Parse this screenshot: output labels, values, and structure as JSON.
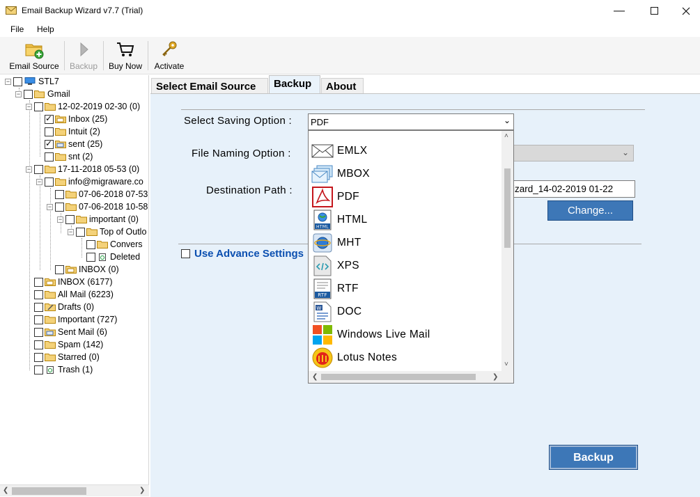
{
  "window": {
    "title": "Email Backup Wizard v7.7 (Trial)"
  },
  "menu": {
    "file": "File",
    "help": "Help"
  },
  "toolbar": {
    "email_source": "Email Source",
    "backup": "Backup",
    "buy_now": "Buy Now",
    "activate": "Activate"
  },
  "tree": {
    "root": "STL7",
    "account": "Gmail",
    "items": [
      "12-02-2019 02-30 (0)",
      "Inbox (25)",
      "Intuit (2)",
      "sent (25)",
      "snt (2)",
      "17-11-2018 05-53 (0)",
      "info@migraware.co",
      "07-06-2018 07-53",
      "07-06-2018 10-58",
      "important (0)",
      "Top of Outlo",
      "Convers",
      "Deleted",
      "INBOX (0)",
      "INBOX (6177)",
      "All Mail (6223)",
      "Drafts (0)",
      "Important (727)",
      "Sent Mail (6)",
      "Spam (142)",
      "Starred (0)",
      "Trash (1)"
    ]
  },
  "tabs": {
    "select_source": "Select Email Source",
    "backup": "Backup",
    "about": "About"
  },
  "form": {
    "saving_label": "Select Saving Option :",
    "saving_value": "PDF",
    "naming_label": "File Naming Option :",
    "dest_label": "Destination Path :",
    "dest_value": "izard_14-02-2019 01-22",
    "change_button": "Change...",
    "advance_settings": "Use Advance Settings",
    "backup_button": "Backup"
  },
  "dropdown": {
    "options": [
      "EMLX",
      "MBOX",
      "PDF",
      "HTML",
      "MHT",
      "XPS",
      "RTF",
      "DOC",
      "Windows Live Mail",
      "Lotus Notes"
    ]
  },
  "colors": {
    "accent_button": "#3d77b7",
    "content_bg": "#e7f1fa",
    "link_blue": "#0b4fb0"
  }
}
